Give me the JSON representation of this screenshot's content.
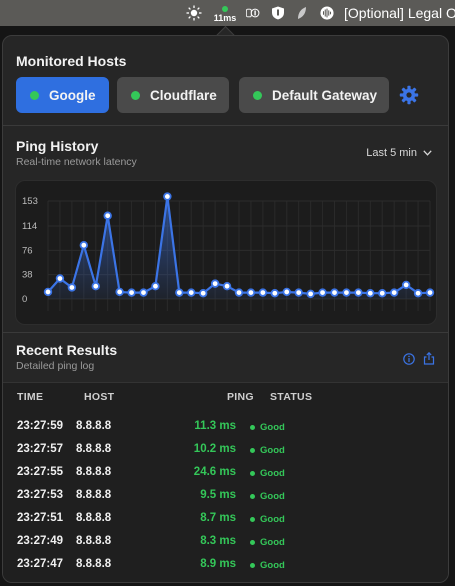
{
  "menubar": {
    "ping_text": "11ms",
    "optional_text": "[Optional] Legal O",
    "icons": [
      "sun-icon",
      "onepassword-icon",
      "shield-icon",
      "leaf-icon",
      "audio-waveform-icon"
    ]
  },
  "hosts": {
    "title": "Monitored Hosts",
    "items": [
      {
        "label": "Google",
        "active": true
      },
      {
        "label": "Cloudflare",
        "active": false
      },
      {
        "label": "Default Gateway",
        "active": false
      }
    ]
  },
  "ping_history": {
    "title": "Ping History",
    "subtitle": "Real-time network latency",
    "range_label": "Last 5 min"
  },
  "chart_data": {
    "type": "area",
    "title": "Ping History",
    "subtitle": "Real-time network latency",
    "xlabel": "",
    "ylabel": "",
    "y_ticks": [
      "153",
      "114",
      "76",
      "38",
      "0"
    ],
    "ylim": [
      0,
      153
    ],
    "grid": true,
    "color": "#3b74e6",
    "values": [
      11,
      32,
      18,
      84,
      20,
      130,
      11,
      10,
      10,
      20,
      160,
      10,
      10,
      9,
      24,
      20,
      10,
      10,
      10,
      9,
      11,
      10,
      8,
      10,
      10,
      10,
      10,
      9,
      9,
      10,
      22,
      9,
      10
    ]
  },
  "recent": {
    "title": "Recent Results",
    "subtitle": "Detailed ping log",
    "columns": {
      "time": "TIME",
      "host": "HOST",
      "ping": "PING",
      "status": "STATUS"
    },
    "rows": [
      {
        "time": "23:27:59",
        "host": "8.8.8.8",
        "ping": "11.3 ms",
        "status": "Good"
      },
      {
        "time": "23:27:57",
        "host": "8.8.8.8",
        "ping": "10.2 ms",
        "status": "Good"
      },
      {
        "time": "23:27:55",
        "host": "8.8.8.8",
        "ping": "24.6 ms",
        "status": "Good"
      },
      {
        "time": "23:27:53",
        "host": "8.8.8.8",
        "ping": "9.5 ms",
        "status": "Good"
      },
      {
        "time": "23:27:51",
        "host": "8.8.8.8",
        "ping": "8.7 ms",
        "status": "Good"
      },
      {
        "time": "23:27:49",
        "host": "8.8.8.8",
        "ping": "8.3 ms",
        "status": "Good"
      },
      {
        "time": "23:27:47",
        "host": "8.8.8.8",
        "ping": "8.9 ms",
        "status": "Good"
      }
    ]
  },
  "colors": {
    "accent": "#2f6fe0",
    "good": "#34c759",
    "line": "#3b74e6"
  }
}
